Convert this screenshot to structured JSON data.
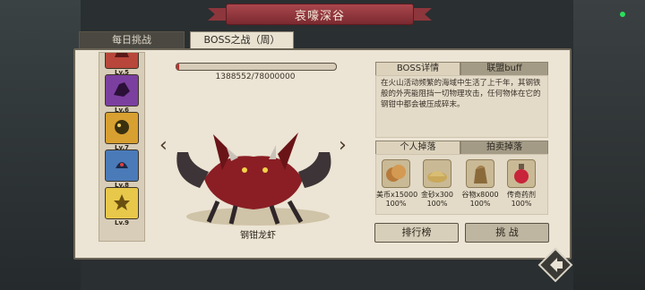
{
  "title": "哀嚎深谷",
  "tabs": {
    "daily": "每日挑战",
    "boss": "BOSS之战（周）"
  },
  "boss_list": [
    {
      "level": "Lv.5",
      "color": "#b8463a"
    },
    {
      "level": "Lv.6",
      "color": "#7b3fa0"
    },
    {
      "level": "Lv.7",
      "color": "#d8a030"
    },
    {
      "level": "Lv.8",
      "color": "#4a7ab8"
    },
    {
      "level": "Lv.9",
      "color": "#e8c84a"
    }
  ],
  "hp": {
    "text": "1388552/78000000",
    "fraction": 0.018
  },
  "boss_name": "钢钳龙虾",
  "info_tabs": {
    "boss_detail": "BOSS详情",
    "union_buff": "联盟buff"
  },
  "description": "在火山活动频繁的海域中生活了上千年，其钢铁般的外壳能阻挡一切物理攻击，任何物体在它的钢钳中都会被压成碎末。",
  "drop_tabs": {
    "personal": "个人掉落",
    "auction": "拍卖掉落"
  },
  "drops": [
    {
      "name": "美币x15000",
      "pct": "100%",
      "icon": "coin-icon"
    },
    {
      "name": "金砂x300",
      "pct": "100%",
      "icon": "gold-sand-icon"
    },
    {
      "name": "谷物x8000",
      "pct": "100%",
      "icon": "grain-icon"
    },
    {
      "name": "传奇药剂",
      "pct": "100%",
      "icon": "potion-icon"
    }
  ],
  "buttons": {
    "rank": "排行榜",
    "fight": "挑 战"
  }
}
